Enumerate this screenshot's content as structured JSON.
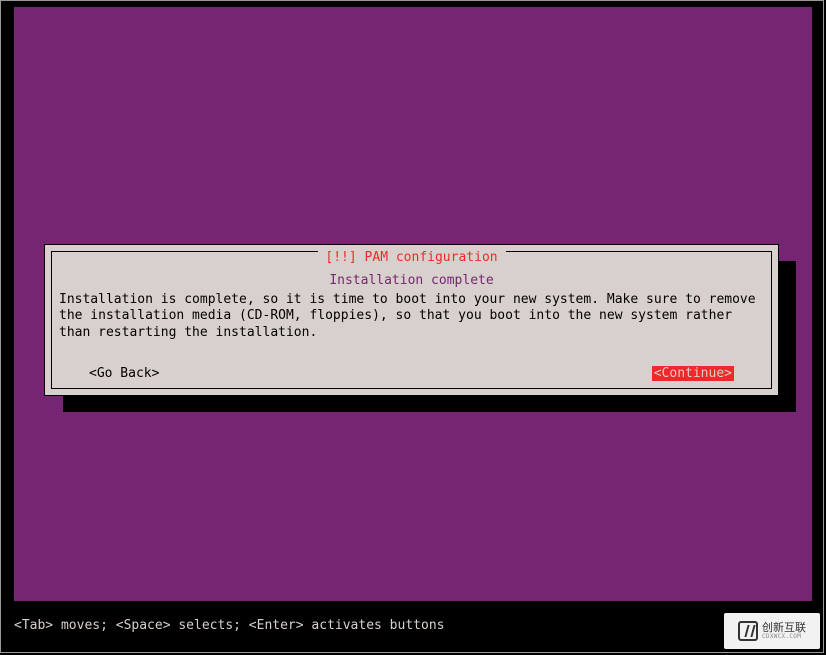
{
  "dialog": {
    "title": "[!!] PAM configuration",
    "subtitle": "Installation complete",
    "body": "Installation is complete, so it is time to boot into your new system. Make sure to remove the installation media (CD-ROM, floppies), so that you boot into the new system rather than restarting the installation.",
    "back_label": "<Go Back>",
    "continue_label": "<Continue>"
  },
  "help_line": "<Tab> moves; <Space> selects; <Enter> activates buttons",
  "watermark": {
    "brand": "创新互联",
    "sub": "CDXWCX.COM"
  },
  "colors": {
    "bg_purple": "#762572",
    "dialog_bg": "#d8d0cc",
    "accent_red": "#ef2929"
  }
}
